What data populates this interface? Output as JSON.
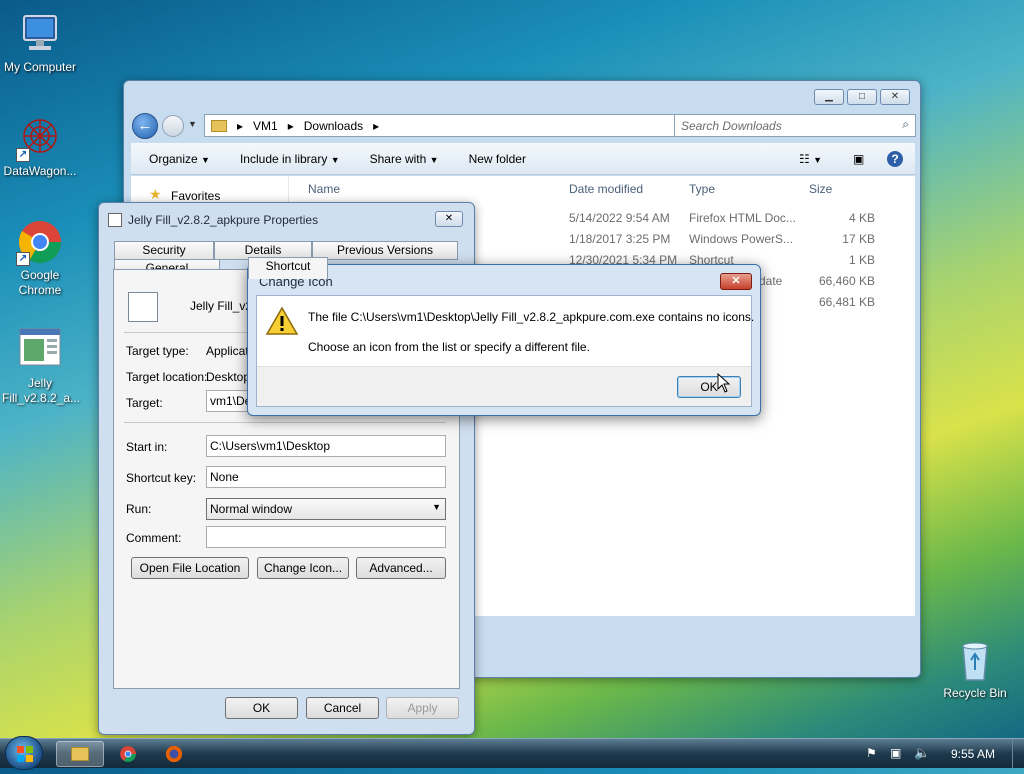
{
  "desktop": {
    "icons": [
      {
        "label": "My Computer",
        "icon": "computer-icon"
      },
      {
        "label": "DataWagon...",
        "icon": "datawagon-icon"
      },
      {
        "label": "Google Chrome",
        "icon": "chrome-icon"
      },
      {
        "label": "Jelly Fill_v2.8.2_a...",
        "icon": "app-shortcut-icon"
      },
      {
        "label": "Recycle Bin",
        "icon": "recycle-bin-icon"
      }
    ]
  },
  "explorer": {
    "path": [
      "VM1",
      "Downloads"
    ],
    "search_placeholder": "Search Downloads",
    "toolbar": {
      "organize": "Organize",
      "include": "Include in library",
      "share": "Share with",
      "new_folder": "New folder"
    },
    "nav": {
      "favorites": "Favorites"
    },
    "columns": [
      "Name",
      "Date modified",
      "Type",
      "Size"
    ],
    "rows": [
      {
        "date": "5/14/2022 9:54 AM",
        "type": "Firefox HTML Doc...",
        "size": "4 KB"
      },
      {
        "date": "1/18/2017 3:25 PM",
        "type": "Windows PowerS...",
        "size": "17 KB"
      },
      {
        "date": "12/30/2021 5:34 PM",
        "type": "Shortcut",
        "size": "1 KB"
      },
      {
        "date": "",
        "type": "date",
        "size": "66,460 KB"
      },
      {
        "date": "",
        "type": "",
        "size": "66,481 KB"
      }
    ]
  },
  "properties": {
    "title": "Jelly Fill_v2.8.2_apkpure Properties",
    "tabs_row1": [
      "Security",
      "Details",
      "Previous Versions"
    ],
    "tabs_row2": [
      "General",
      "Shortcut"
    ],
    "file_name": "Jelly Fill_v2.",
    "labels": {
      "target_type": "Target type:",
      "target_location": "Target location:",
      "target": "Target:",
      "start_in": "Start in:",
      "shortcut_key": "Shortcut key:",
      "run": "Run:",
      "comment": "Comment:"
    },
    "values": {
      "target_type": "Applicati",
      "target_location": "Desktop",
      "target": "vm1\\De",
      "start_in": "C:\\Users\\vm1\\Desktop",
      "shortcut_key": "None",
      "run": "Normal window",
      "comment": ""
    },
    "buttons": {
      "open_location": "Open File Location",
      "change_icon": "Change Icon...",
      "advanced": "Advanced...",
      "ok": "OK",
      "cancel": "Cancel",
      "apply": "Apply"
    }
  },
  "message": {
    "title": "Change Icon",
    "line1": "The file C:\\Users\\vm1\\Desktop\\Jelly Fill_v2.8.2_apkpure.com.exe contains no icons.",
    "line2": "Choose an icon from the list or specify a different file.",
    "ok": "OK"
  },
  "taskbar": {
    "clock": "9:55 AM"
  }
}
